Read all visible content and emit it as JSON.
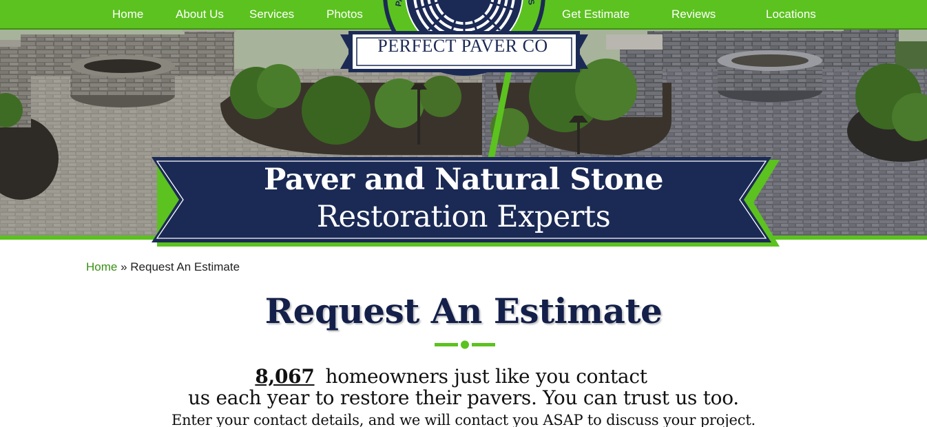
{
  "nav": {
    "items": [
      {
        "label": "Home"
      },
      {
        "label": "About Us"
      },
      {
        "label": "Services"
      },
      {
        "label": "Photos"
      },
      {
        "label": "Get Estimate"
      },
      {
        "label": "Reviews"
      },
      {
        "label": "Locations"
      }
    ]
  },
  "logo": {
    "name": "PERFECT PAVER CO",
    "ring_left": "PAV",
    "ring_right": "RTS"
  },
  "banner": {
    "line1": "Paver and Natural Stone",
    "line2": "Restoration Experts"
  },
  "breadcrumb": {
    "home": "Home",
    "separator": " » ",
    "current": "Request An Estimate"
  },
  "page": {
    "title": "Request An Estimate",
    "homeowner_count": "8,067",
    "intro_line1": "homeowners just like you contact",
    "intro_line2": "us each year to restore their pavers. You can trust us too.",
    "intro_line3": "Enter your contact details, and we will contact you ASAP to discuss your project."
  },
  "colors": {
    "brand_green": "#5cc21f",
    "brand_navy": "#1b2a55",
    "title_navy": "#14204a",
    "link_green": "#3a8f16"
  }
}
